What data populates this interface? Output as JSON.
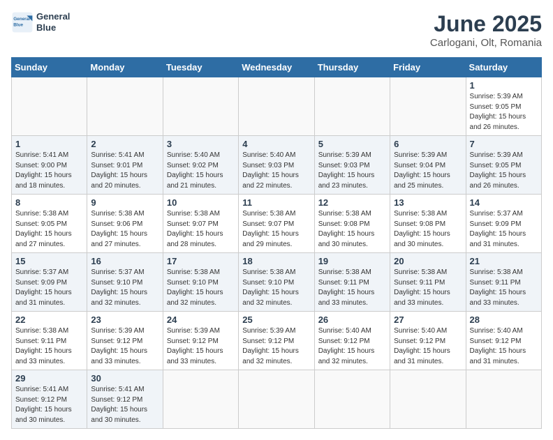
{
  "header": {
    "logo_line1": "General",
    "logo_line2": "Blue",
    "title": "June 2025",
    "subtitle": "Carlogani, Olt, Romania"
  },
  "calendar": {
    "days_of_week": [
      "Sunday",
      "Monday",
      "Tuesday",
      "Wednesday",
      "Thursday",
      "Friday",
      "Saturday"
    ],
    "weeks": [
      [
        {
          "day": "",
          "empty": true
        },
        {
          "day": "",
          "empty": true
        },
        {
          "day": "",
          "empty": true
        },
        {
          "day": "",
          "empty": true
        },
        {
          "day": "",
          "empty": true
        },
        {
          "day": "",
          "empty": true
        },
        {
          "day": "1",
          "sunrise": "Sunrise: 5:39 AM",
          "sunset": "Sunset: 9:05 PM",
          "daylight": "Daylight: 15 hours and 26 minutes."
        }
      ],
      [
        {
          "day": "1",
          "sunrise": "Sunrise: 5:41 AM",
          "sunset": "Sunset: 9:00 PM",
          "daylight": "Daylight: 15 hours and 18 minutes."
        },
        {
          "day": "2",
          "sunrise": "Sunrise: 5:41 AM",
          "sunset": "Sunset: 9:01 PM",
          "daylight": "Daylight: 15 hours and 20 minutes."
        },
        {
          "day": "3",
          "sunrise": "Sunrise: 5:40 AM",
          "sunset": "Sunset: 9:02 PM",
          "daylight": "Daylight: 15 hours and 21 minutes."
        },
        {
          "day": "4",
          "sunrise": "Sunrise: 5:40 AM",
          "sunset": "Sunset: 9:03 PM",
          "daylight": "Daylight: 15 hours and 22 minutes."
        },
        {
          "day": "5",
          "sunrise": "Sunrise: 5:39 AM",
          "sunset": "Sunset: 9:03 PM",
          "daylight": "Daylight: 15 hours and 23 minutes."
        },
        {
          "day": "6",
          "sunrise": "Sunrise: 5:39 AM",
          "sunset": "Sunset: 9:04 PM",
          "daylight": "Daylight: 15 hours and 25 minutes."
        },
        {
          "day": "7",
          "sunrise": "Sunrise: 5:39 AM",
          "sunset": "Sunset: 9:05 PM",
          "daylight": "Daylight: 15 hours and 26 minutes."
        }
      ],
      [
        {
          "day": "8",
          "sunrise": "Sunrise: 5:38 AM",
          "sunset": "Sunset: 9:05 PM",
          "daylight": "Daylight: 15 hours and 27 minutes."
        },
        {
          "day": "9",
          "sunrise": "Sunrise: 5:38 AM",
          "sunset": "Sunset: 9:06 PM",
          "daylight": "Daylight: 15 hours and 27 minutes."
        },
        {
          "day": "10",
          "sunrise": "Sunrise: 5:38 AM",
          "sunset": "Sunset: 9:07 PM",
          "daylight": "Daylight: 15 hours and 28 minutes."
        },
        {
          "day": "11",
          "sunrise": "Sunrise: 5:38 AM",
          "sunset": "Sunset: 9:07 PM",
          "daylight": "Daylight: 15 hours and 29 minutes."
        },
        {
          "day": "12",
          "sunrise": "Sunrise: 5:38 AM",
          "sunset": "Sunset: 9:08 PM",
          "daylight": "Daylight: 15 hours and 30 minutes."
        },
        {
          "day": "13",
          "sunrise": "Sunrise: 5:38 AM",
          "sunset": "Sunset: 9:08 PM",
          "daylight": "Daylight: 15 hours and 30 minutes."
        },
        {
          "day": "14",
          "sunrise": "Sunrise: 5:37 AM",
          "sunset": "Sunset: 9:09 PM",
          "daylight": "Daylight: 15 hours and 31 minutes."
        }
      ],
      [
        {
          "day": "15",
          "sunrise": "Sunrise: 5:37 AM",
          "sunset": "Sunset: 9:09 PM",
          "daylight": "Daylight: 15 hours and 31 minutes."
        },
        {
          "day": "16",
          "sunrise": "Sunrise: 5:37 AM",
          "sunset": "Sunset: 9:10 PM",
          "daylight": "Daylight: 15 hours and 32 minutes."
        },
        {
          "day": "17",
          "sunrise": "Sunrise: 5:38 AM",
          "sunset": "Sunset: 9:10 PM",
          "daylight": "Daylight: 15 hours and 32 minutes."
        },
        {
          "day": "18",
          "sunrise": "Sunrise: 5:38 AM",
          "sunset": "Sunset: 9:10 PM",
          "daylight": "Daylight: 15 hours and 32 minutes."
        },
        {
          "day": "19",
          "sunrise": "Sunrise: 5:38 AM",
          "sunset": "Sunset: 9:11 PM",
          "daylight": "Daylight: 15 hours and 33 minutes."
        },
        {
          "day": "20",
          "sunrise": "Sunrise: 5:38 AM",
          "sunset": "Sunset: 9:11 PM",
          "daylight": "Daylight: 15 hours and 33 minutes."
        },
        {
          "day": "21",
          "sunrise": "Sunrise: 5:38 AM",
          "sunset": "Sunset: 9:11 PM",
          "daylight": "Daylight: 15 hours and 33 minutes."
        }
      ],
      [
        {
          "day": "22",
          "sunrise": "Sunrise: 5:38 AM",
          "sunset": "Sunset: 9:11 PM",
          "daylight": "Daylight: 15 hours and 33 minutes."
        },
        {
          "day": "23",
          "sunrise": "Sunrise: 5:39 AM",
          "sunset": "Sunset: 9:12 PM",
          "daylight": "Daylight: 15 hours and 33 minutes."
        },
        {
          "day": "24",
          "sunrise": "Sunrise: 5:39 AM",
          "sunset": "Sunset: 9:12 PM",
          "daylight": "Daylight: 15 hours and 33 minutes."
        },
        {
          "day": "25",
          "sunrise": "Sunrise: 5:39 AM",
          "sunset": "Sunset: 9:12 PM",
          "daylight": "Daylight: 15 hours and 32 minutes."
        },
        {
          "day": "26",
          "sunrise": "Sunrise: 5:40 AM",
          "sunset": "Sunset: 9:12 PM",
          "daylight": "Daylight: 15 hours and 32 minutes."
        },
        {
          "day": "27",
          "sunrise": "Sunrise: 5:40 AM",
          "sunset": "Sunset: 9:12 PM",
          "daylight": "Daylight: 15 hours and 31 minutes."
        },
        {
          "day": "28",
          "sunrise": "Sunrise: 5:40 AM",
          "sunset": "Sunset: 9:12 PM",
          "daylight": "Daylight: 15 hours and 31 minutes."
        }
      ],
      [
        {
          "day": "29",
          "sunrise": "Sunrise: 5:41 AM",
          "sunset": "Sunset: 9:12 PM",
          "daylight": "Daylight: 15 hours and 30 minutes."
        },
        {
          "day": "30",
          "sunrise": "Sunrise: 5:41 AM",
          "sunset": "Sunset: 9:12 PM",
          "daylight": "Daylight: 15 hours and 30 minutes."
        },
        {
          "day": "",
          "empty": true
        },
        {
          "day": "",
          "empty": true
        },
        {
          "day": "",
          "empty": true
        },
        {
          "day": "",
          "empty": true
        },
        {
          "day": "",
          "empty": true
        }
      ]
    ]
  }
}
